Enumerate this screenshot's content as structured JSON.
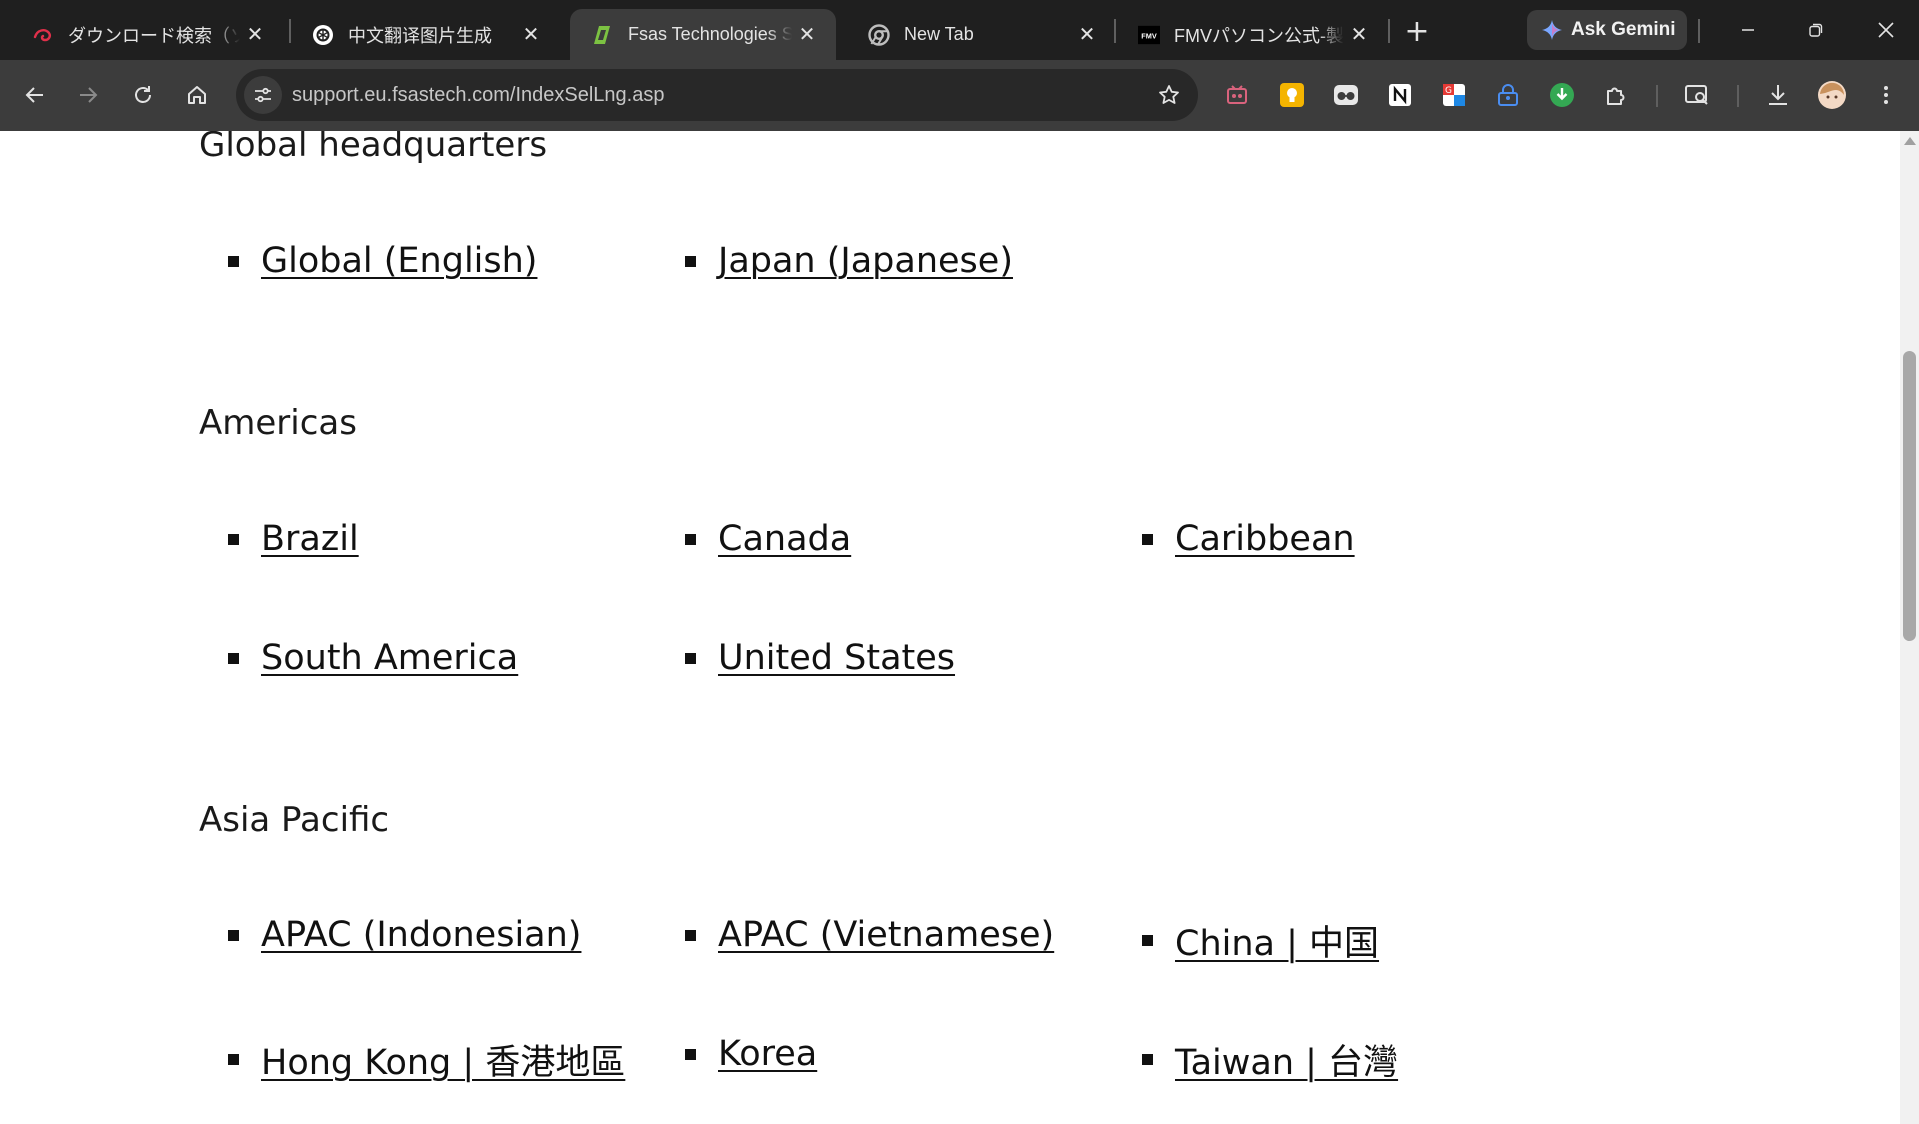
{
  "browser": {
    "tabs": [
      {
        "title": "ダウンロード検索（ソフトウェア）",
        "favicon": "swirl-icon",
        "active": false
      },
      {
        "title": "中文翻译图片生成",
        "favicon": "openai-icon",
        "active": false
      },
      {
        "title": "Fsas Technologies Support",
        "favicon": "fsas-icon",
        "active": true
      },
      {
        "title": "New Tab",
        "favicon": "chrome-icon",
        "active": false
      },
      {
        "title": "FMVパソコン公式-製品情報",
        "favicon": "fmv-icon",
        "active": false
      }
    ],
    "fmv_badge": "FMV",
    "new_tab_glyph": "+",
    "close_glyph": "✕",
    "gemini_label": "Ask Gemini",
    "url": "support.eu.fsastech.com/IndexSelLng.asp",
    "extension_icons": [
      "cassette-icon",
      "lightbulb-icon",
      "glasses-icon",
      "notion-icon",
      "translate-icon",
      "lock-person-icon",
      "download-circle-icon",
      "puzzle-icon"
    ],
    "accent_color": "#3c3c3c"
  },
  "page": {
    "sections": [
      {
        "heading": "Global headquarters",
        "links": [
          "Global (English)",
          "Japan (Japanese)"
        ]
      },
      {
        "heading": "Americas",
        "links": [
          "Brazil",
          "Canada",
          "Caribbean",
          "South America",
          "United States"
        ]
      },
      {
        "heading": "Asia Pacific",
        "links": [
          "APAC (Indonesian)",
          "APAC (Vietnamese)",
          "China | 中国",
          "Hong Kong | 香港地區",
          "Korea",
          "Taiwan | 台灣"
        ]
      }
    ]
  }
}
